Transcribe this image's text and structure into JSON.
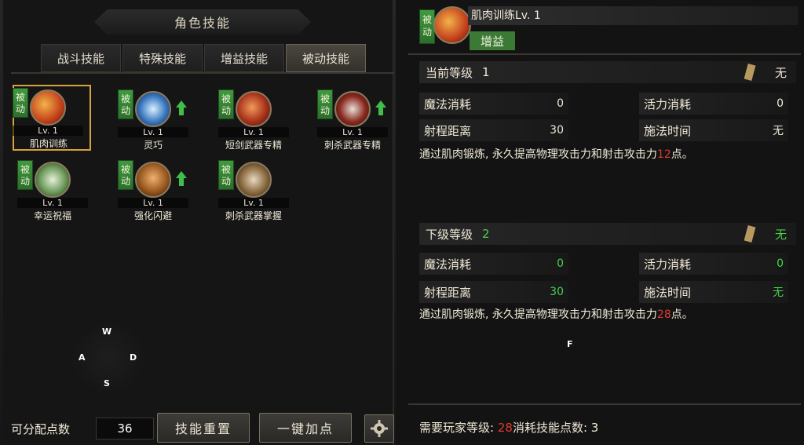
{
  "panel": {
    "title": "角色技能",
    "tabs": [
      "战斗技能",
      "特殊技能",
      "增益技能",
      "被动技能"
    ]
  },
  "skills": [
    {
      "badge": "被动",
      "level": "Lv. 1",
      "name": "肌肉训练",
      "upgrade": false
    },
    {
      "badge": "被动",
      "level": "Lv. 1",
      "name": "灵巧",
      "upgrade": true
    },
    {
      "badge": "被动",
      "level": "Lv. 1",
      "name": "短剑武器专精",
      "upgrade": false
    },
    {
      "badge": "被动",
      "level": "Lv. 1",
      "name": "刺杀武器专精",
      "upgrade": true
    },
    {
      "badge": "被动",
      "level": "Lv. 1",
      "name": "幸运祝福",
      "upgrade": false
    },
    {
      "badge": "被动",
      "level": "Lv. 1",
      "name": "强化闪避",
      "upgrade": true
    },
    {
      "badge": "被动",
      "level": "Lv. 1",
      "name": "刺杀武器掌握",
      "upgrade": false
    }
  ],
  "wasd": {
    "w": "W",
    "a": "A",
    "s": "S",
    "d": "D"
  },
  "bottom": {
    "points_label": "可分配点数",
    "points_value": "36",
    "reset_label": "技能重置",
    "auto_add_label": "一键加点"
  },
  "detail": {
    "badge": "被动",
    "title": "肌肉训练Lv. 1",
    "tag": "增益",
    "current": {
      "label": "当前等级",
      "level": "1",
      "value": "无",
      "mana_label": "魔法消耗",
      "mana": "0",
      "vigor_label": "活力消耗",
      "vigor": "0",
      "range_label": "射程距离",
      "range": "30",
      "cast_label": "施法时间",
      "cast": "无",
      "desc_pre": "通过肌肉锻炼, 永久提高物理攻击力和射击攻击力",
      "desc_num": "12",
      "desc_post": "点。"
    },
    "next": {
      "label": "下级等级",
      "level": "2",
      "value": "无",
      "mana_label": "魔法消耗",
      "mana": "0",
      "vigor_label": "活力消耗",
      "vigor": "0",
      "range_label": "射程距离",
      "range": "30",
      "cast_label": "施法时间",
      "cast": "无",
      "desc_pre": "通过肌肉锻炼, 永久提高物理攻击力和射击攻击力",
      "desc_num": "28",
      "desc_post": "点。"
    },
    "requirement": {
      "level_label": "需要玩家等级:",
      "level_value": "28",
      "points_label": "消耗技能点数:",
      "points_value": "3"
    },
    "f_key": "F"
  }
}
